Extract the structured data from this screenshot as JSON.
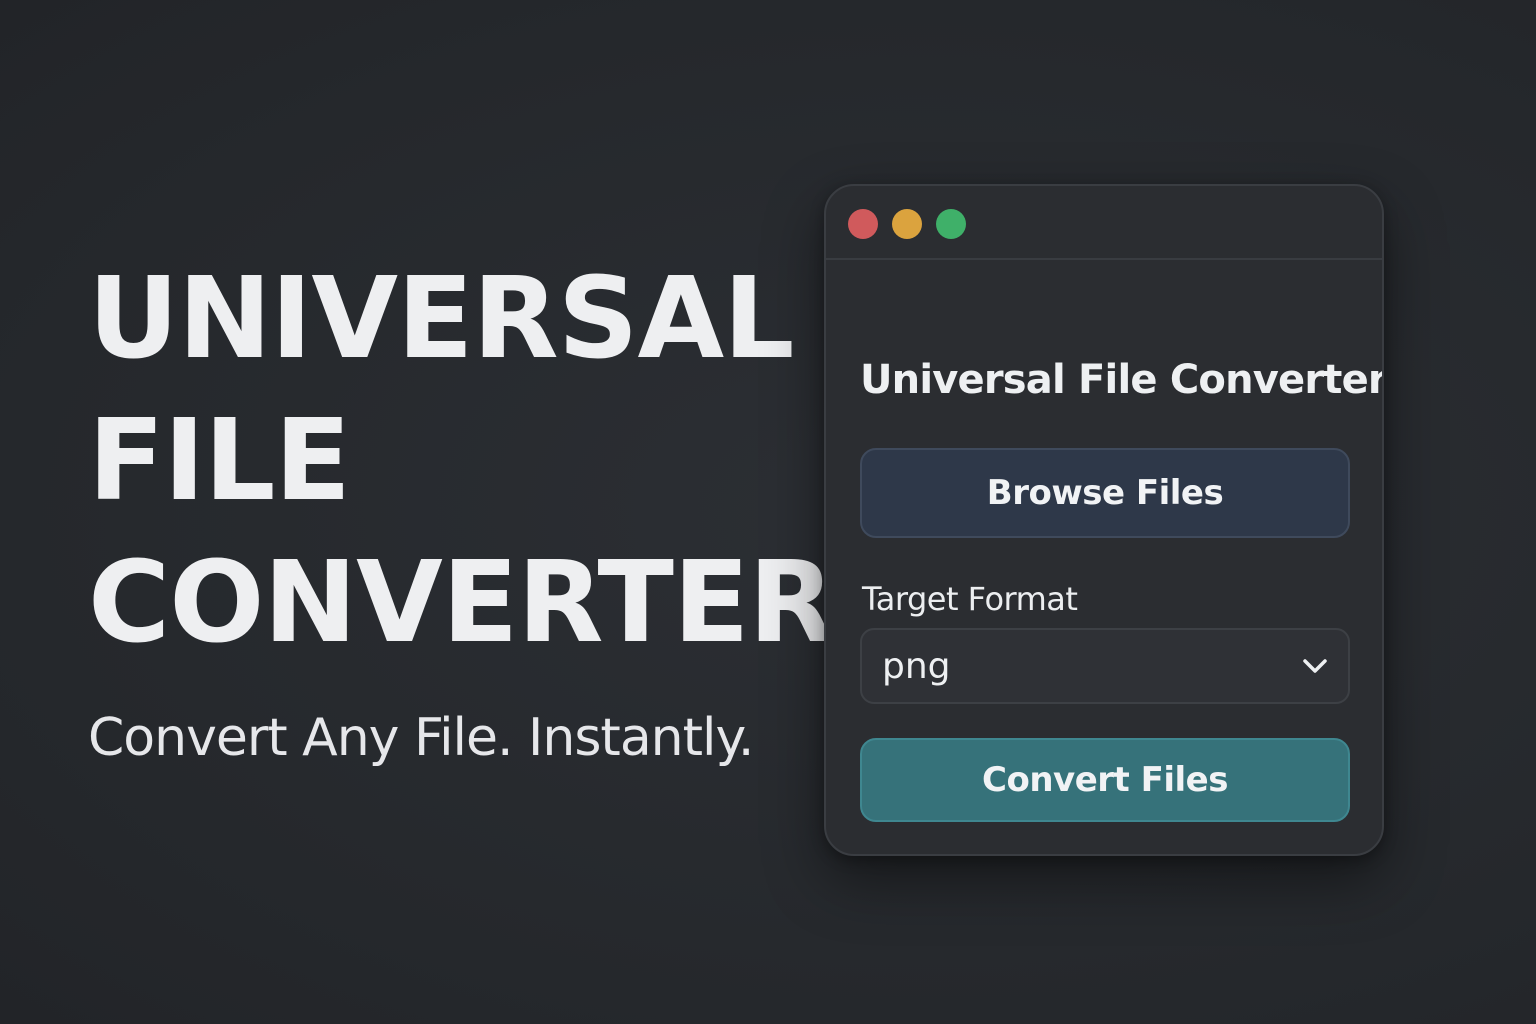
{
  "hero": {
    "lines": [
      "UNIVERSAL",
      "FILE",
      "CONVERTER"
    ],
    "tagline": "Convert Any File. Instantly."
  },
  "window": {
    "title": "Universal File Converter",
    "browse_label": "Browse Files",
    "format_label": "Target Format",
    "format_value": "png",
    "convert_label": "Convert Files"
  },
  "icons": {
    "traffic_lights": [
      "close-icon",
      "minimize-icon",
      "maximize-icon"
    ],
    "dropdown": "chevron-down-icon"
  },
  "colors": {
    "background": "#292c31",
    "window": "#2b2d31",
    "browse_button": "#2e3849",
    "convert_button": "#36727a",
    "traffic_red": "#d05a5c",
    "traffic_yellow": "#dba33e",
    "traffic_green": "#3fb069"
  }
}
